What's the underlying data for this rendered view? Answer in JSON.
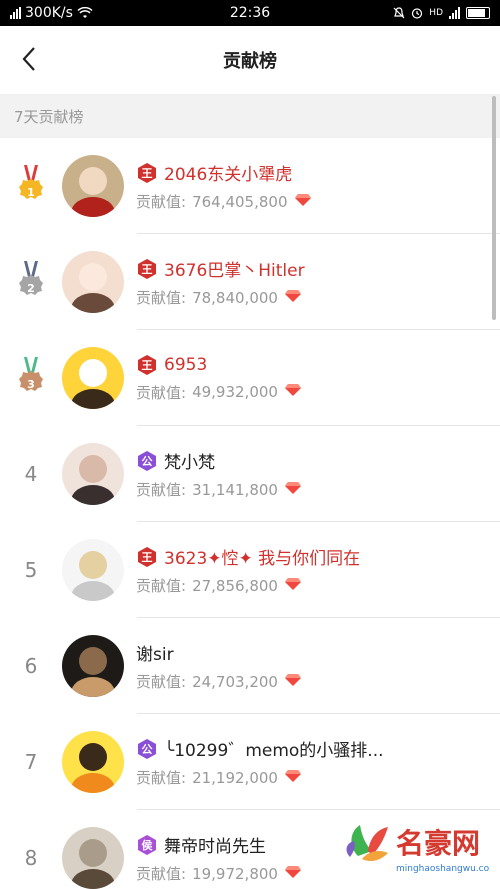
{
  "status": {
    "speed": "300K/s",
    "time": "22:36"
  },
  "nav": {
    "title": "贡献榜"
  },
  "section": {
    "title": "7天贡献榜"
  },
  "colors": {
    "red": "#d0312d",
    "purple": "#8a4fd6",
    "gold": "#f5b623",
    "silver": "#a5a5a5",
    "bronze": "#c8906a"
  },
  "rows": [
    {
      "rank": "1",
      "badge_text": "王",
      "badge_color": "#d0312d",
      "name": "2046东关小犟虎",
      "value_label": "贡献值:",
      "value": "764,405,800"
    },
    {
      "rank": "2",
      "badge_text": "王",
      "badge_color": "#d0312d",
      "name": "3676巴掌丶Hitler",
      "value_label": "贡献值:",
      "value": "78,840,000"
    },
    {
      "rank": "3",
      "badge_text": "王",
      "badge_color": "#d0312d",
      "name": "6953",
      "value_label": "贡献值:",
      "value": "49,932,000"
    },
    {
      "rank": "4",
      "badge_text": "公",
      "badge_color": "#8a4fd6",
      "name": "梵小梵",
      "value_label": "贡献值:",
      "value": "31,141,800"
    },
    {
      "rank": "5",
      "badge_text": "王",
      "badge_color": "#d0312d",
      "name": "3623✦悾✦ 我与你们同在",
      "value_label": "贡献值:",
      "value": "27,856,800"
    },
    {
      "rank": "6",
      "badge_text": "",
      "badge_color": "",
      "name": "谢sir",
      "value_label": "贡献值:",
      "value": "24,703,200"
    },
    {
      "rank": "7",
      "badge_text": "公",
      "badge_color": "#8a4fd6",
      "name": "╰10299゛memo的小骚排...",
      "value_label": "贡献值:",
      "value": "21,192,000"
    },
    {
      "rank": "8",
      "badge_text": "侯",
      "badge_color": "#a84fd6",
      "name": "舞帝时尚先生",
      "value_label": "贡献值:",
      "value": "19,972,800"
    }
  ],
  "watermark": {
    "text": "名豪网",
    "sub": "minghaoshangwu.com"
  }
}
